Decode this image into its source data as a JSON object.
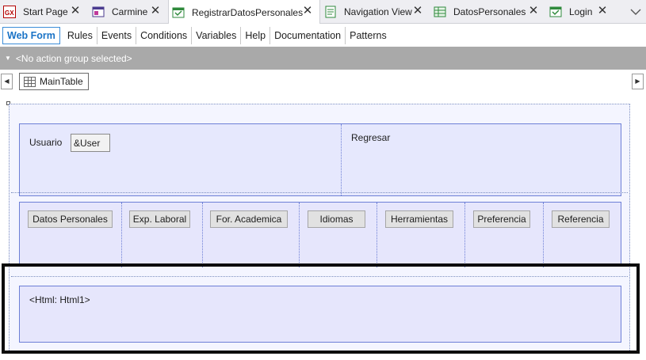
{
  "tabs": [
    {
      "label": "Start Page",
      "icon": "gx-logo-icon"
    },
    {
      "label": "Carmine",
      "icon": "theme-window-icon"
    },
    {
      "label": "RegistrarDatosPersonales",
      "icon": "webpanel-icon",
      "active": true
    },
    {
      "label": "Navigation View",
      "icon": "navigation-view-icon"
    },
    {
      "label": "DatosPersonales",
      "icon": "transaction-table-icon"
    },
    {
      "label": "Login",
      "icon": "webpanel-icon"
    }
  ],
  "section_tabs": [
    "Web Form",
    "Rules",
    "Events",
    "Conditions",
    "Variables",
    "Help",
    "Documentation",
    "Patterns"
  ],
  "action_bar": {
    "label": "<No action group selected>"
  },
  "breadcrumb": {
    "label": "MainTable"
  },
  "form": {
    "usuario_label": "Usuario",
    "user_var": "&User",
    "regresar_label": "Regresar",
    "buttons": [
      "Datos Personales",
      "Exp. Laboral",
      "For. Academica",
      "Idiomas",
      "Herramientas",
      "Preferencia",
      "Referencia"
    ],
    "html_control": "<Html: Html1>"
  },
  "colors": {
    "accent": "#1a73c6",
    "action_bar": "#a9a9a9",
    "table_fill": "#e6e8fd",
    "table_border": "#6d7fd6"
  }
}
